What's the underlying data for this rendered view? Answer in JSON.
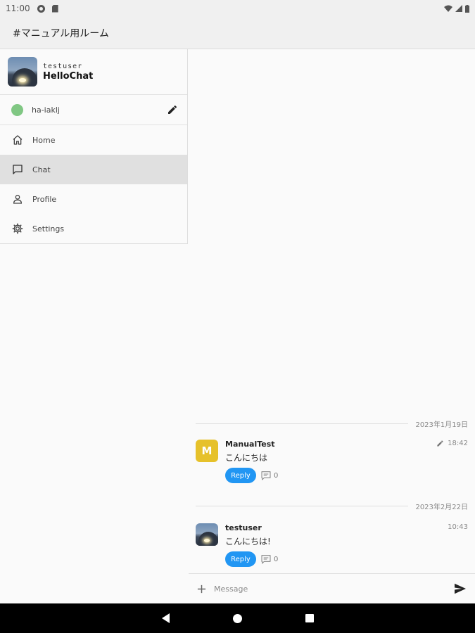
{
  "status_bar": {
    "time": "11:00"
  },
  "app_bar": {
    "title": "#マニュアル用ルーム"
  },
  "drawer": {
    "username": "testuser",
    "app_name": "HelloChat",
    "status_text": "ha-iaklj",
    "status_color": "#80c783",
    "items": [
      {
        "label": "Home",
        "icon": "home-icon",
        "active": false
      },
      {
        "label": "Chat",
        "icon": "chat-icon",
        "active": true
      },
      {
        "label": "Profile",
        "icon": "person-icon",
        "active": false
      },
      {
        "label": "Settings",
        "icon": "gear-icon",
        "active": false
      }
    ]
  },
  "messages": {
    "date1": "2023年1月19日",
    "msg1": {
      "avatar_letter": "M",
      "author": "ManualTest",
      "text": "こんにちは",
      "time": "18:42",
      "reply_label": "Reply",
      "thread_count": "0"
    },
    "date2": "2023年2月22日",
    "msg2": {
      "author": "testuser",
      "text": "こんにちは!",
      "time": "10:43",
      "reply_label": "Reply",
      "thread_count": "0"
    }
  },
  "composer": {
    "placeholder": "Message"
  },
  "colors": {
    "accent": "#2196f3",
    "avatar_yellow": "#e6c12a",
    "active_bg": "#e0e0e0"
  }
}
